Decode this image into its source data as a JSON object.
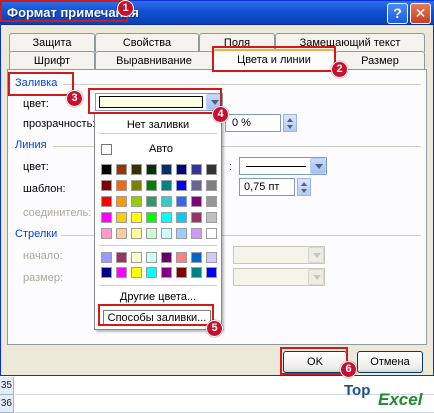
{
  "window": {
    "title": "Формат примечания",
    "help_glyph": "?",
    "close_glyph": "✕"
  },
  "tabs": {
    "row1": [
      "Защита",
      "Свойства",
      "Поля",
      "Замещающий текст"
    ],
    "row2": [
      "Шрифт",
      "Выравнивание",
      "Цвета и линии",
      "Размер"
    ],
    "active": "Цвета и линии"
  },
  "fill": {
    "group_label": "Заливка",
    "color_label": "цвет:",
    "color_value": "#ffffe1",
    "transparency_label": "прозрачность:",
    "transparency_value": "0 %"
  },
  "line": {
    "group_label": "Линия",
    "color_label": "цвет:",
    "pattern_label": "шаблон:",
    "weight_value": "0,75 пт",
    "connector_label": "соединитель:"
  },
  "arrows": {
    "group_label": "Стрелки",
    "start_label": "начало:",
    "size_label": "размер:"
  },
  "color_popup": {
    "no_fill": "Нет заливки",
    "auto": "Авто",
    "more_colors": "Другие цвета...",
    "fill_effects": "Способы заливки...",
    "palette_rows": [
      [
        "#000000",
        "#993300",
        "#333300",
        "#003300",
        "#003366",
        "#000080",
        "#333399",
        "#333333"
      ],
      [
        "#800000",
        "#ff6600",
        "#808000",
        "#008000",
        "#008080",
        "#0000ff",
        "#666699",
        "#808080"
      ],
      [
        "#ff0000",
        "#ff9900",
        "#99cc00",
        "#339966",
        "#33cccc",
        "#3366ff",
        "#800080",
        "#969696"
      ],
      [
        "#ff00ff",
        "#ffcc00",
        "#ffff00",
        "#00ff00",
        "#00ffff",
        "#00ccff",
        "#993366",
        "#c0c0c0"
      ],
      [
        "#ff99cc",
        "#ffcc99",
        "#ffff99",
        "#ccffcc",
        "#ccffff",
        "#99ccff",
        "#cc99ff",
        "#ffffff"
      ]
    ],
    "extra_rows": [
      [
        "#9999ff",
        "#993366",
        "#ffffcc",
        "#ccffff",
        "#660066",
        "#ff8080",
        "#0066cc",
        "#ccccff"
      ],
      [
        "#000080",
        "#ff00ff",
        "#ffff00",
        "#00ffff",
        "#800080",
        "#800000",
        "#008080",
        "#0000ff"
      ]
    ]
  },
  "buttons": {
    "ok": "OK",
    "cancel": "Отмена"
  },
  "badges": [
    "1",
    "2",
    "3",
    "4",
    "5",
    "6"
  ],
  "sheet": {
    "row_numbers": [
      "35",
      "36"
    ]
  },
  "watermark": {
    "top": "Top",
    "brand": "Excel"
  },
  "colors": {
    "title_bar": "#0b47c2",
    "accent_red": "#d11a1a",
    "group_label": "#0046d5"
  }
}
